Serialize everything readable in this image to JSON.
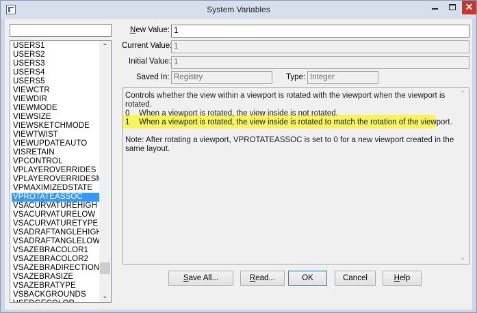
{
  "window": {
    "title": "System Variables",
    "close_glyph": "✕"
  },
  "search": {
    "value": ""
  },
  "variables": {
    "items": [
      "USERS1",
      "USERS2",
      "USERS3",
      "USERS4",
      "USERS5",
      "VIEWCTR",
      "VIEWDIR",
      "VIEWMODE",
      "VIEWSIZE",
      "VIEWSKETCHMODE",
      "VIEWTWIST",
      "VIEWUPDATEAUTO",
      "VISRETAIN",
      "VPCONTROL",
      "VPLAYEROVERRIDES",
      "VPLAYEROVERRIDESMODE",
      "VPMAXIMIZEDSTATE",
      "VPROTATEASSOC",
      "VSACURVATUREHIGH",
      "VSACURVATURELOW",
      "VSACURVATURETYPE",
      "VSADRAFTANGLEHIGH",
      "VSADRAFTANGLELOW",
      "VSAZEBRACOLOR1",
      "VSAZEBRACOLOR2",
      "VSAZEBRADIRECTION",
      "VSAZEBRASIZE",
      "VSAZEBRATYPE",
      "VSBACKGROUNDS",
      "VSEDGECOLOR"
    ],
    "selected": "VPROTATEASSOC",
    "scroll_up_glyph": "⌃",
    "scroll_down_glyph": "⌄"
  },
  "fields": {
    "new_value_label_u": "N",
    "new_value_label_rest": "ew Value:",
    "new_value": "1",
    "current_value_label": "Current Value:",
    "current_value": "1",
    "initial_value_label": "Initial Value:",
    "initial_value": "1",
    "saved_in_label": "Saved In:",
    "saved_in": "Registry",
    "type_label": "Type:",
    "type": "Integer"
  },
  "description": {
    "summary": "Controls whether the view within a viewport is rotated with the viewport when the viewport is rotated.",
    "options": [
      {
        "value": "0",
        "text": "When a viewport is rotated, the view inside is not rotated."
      },
      {
        "value": "1",
        "text": "When a viewport is rotated, the view inside is rotated to match the rotation of the viewport."
      }
    ],
    "note": "Note: After rotating a viewport, VPROTATEASSOC is set to 0 for a new viewport created in the same layout.",
    "highlight_color": "#f5f44a"
  },
  "buttons": {
    "save_all_u": "S",
    "save_all_rest": "ave All...",
    "read_u": "R",
    "read_rest": "ead...",
    "ok": "OK",
    "cancel": "Cancel",
    "help_u": "H",
    "help_rest": "elp"
  },
  "colors": {
    "selection": "#3399ff",
    "titlebar": "#d7dfed",
    "close": "#c7382c"
  }
}
